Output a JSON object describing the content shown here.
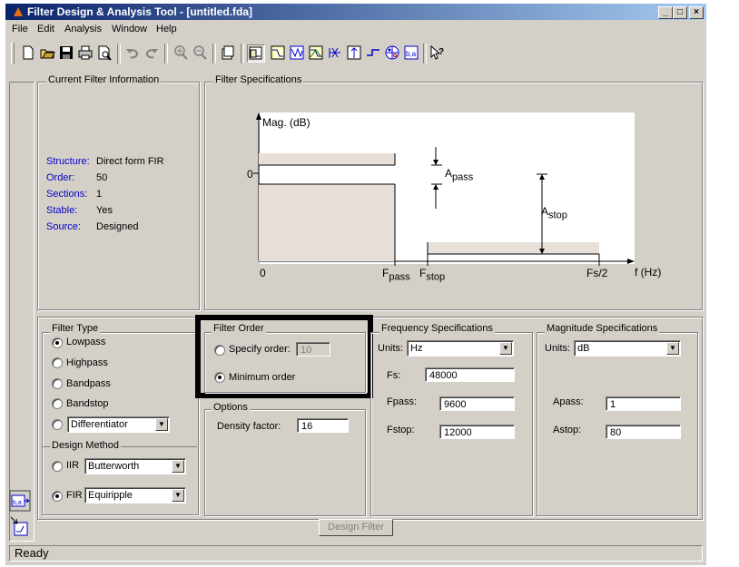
{
  "window": {
    "title": "Filter Design & Analysis Tool - [untitled.fda]",
    "title_buttons": [
      "_",
      "□",
      "×"
    ]
  },
  "menu": [
    "File",
    "Edit",
    "Analysis",
    "Window",
    "Help"
  ],
  "toolbar": {
    "icons": [
      "new-icon",
      "open-icon",
      "save-icon",
      "print-icon",
      "print-preview-icon",
      "undo-icon",
      "redo-icon",
      "zoom-in-icon",
      "zoom-out-icon",
      "new-figure-icon",
      "filter-specs-icon",
      "magnitude-response-icon",
      "phase-response-icon",
      "mag-phase-icon",
      "group-delay-icon",
      "impulse-response-icon",
      "step-response-icon",
      "pole-zero-icon",
      "filter-coefficients-icon",
      "whats-this-icon"
    ]
  },
  "current_filter": {
    "title": "Current Filter Information",
    "rows": [
      {
        "label": "Structure:",
        "value": "Direct form FIR"
      },
      {
        "label": "Order:",
        "value": "50"
      },
      {
        "label": "Sections:",
        "value": "1"
      },
      {
        "label": "Stable:",
        "value": "Yes"
      },
      {
        "label": "Source:",
        "value": "Designed"
      }
    ]
  },
  "filter_specs": {
    "title": "Filter Specifications",
    "mag_label": "Mag. (dB)",
    "zero_y": "0",
    "zero_x": "0",
    "apass": {
      "main": "A",
      "sub": "pass"
    },
    "astop": {
      "main": "A",
      "sub": "stop"
    },
    "fpass": {
      "main": "F",
      "sub": "pass"
    },
    "fstop": {
      "main": "F",
      "sub": "stop"
    },
    "fs2": "Fs/2",
    "f_hz": "f (Hz)"
  },
  "filter_type": {
    "title": "Filter Type",
    "options": [
      "Lowpass",
      "Highpass",
      "Bandpass",
      "Bandstop"
    ],
    "selected": "Lowpass",
    "differentiator": "Differentiator"
  },
  "design_method": {
    "title": "Design Method",
    "iir_label": "IIR",
    "iir_value": "Butterworth",
    "fir_label": "FIR",
    "fir_value": "Equiripple",
    "selected": "FIR"
  },
  "filter_order": {
    "title": "Filter Order",
    "specify_label": "Specify order:",
    "specify_value": "10",
    "minimum_label": "Minimum order",
    "selected": "Minimum order"
  },
  "options": {
    "title": "Options",
    "density_label": "Density factor:",
    "density_value": "16"
  },
  "freq_specs": {
    "title": "Frequency Specifications",
    "units_label": "Units:",
    "units_value": "Hz",
    "fs_label": "Fs:",
    "fs_value": "48000",
    "fpass_label": "Fpass:",
    "fpass_value": "9600",
    "fstop_label": "Fstop:",
    "fstop_value": "12000"
  },
  "mag_specs": {
    "title": "Magnitude Specifications",
    "units_label": "Units:",
    "units_value": "dB",
    "apass_label": "Apass:",
    "apass_value": "1",
    "astop_label": "Astop:",
    "astop_value": "80"
  },
  "design_button": "Design Filter",
  "status": "Ready",
  "colors": {
    "band_fill": "#e8e0d8",
    "highlight_box": "#000000",
    "label_blue": "#0000cc"
  }
}
